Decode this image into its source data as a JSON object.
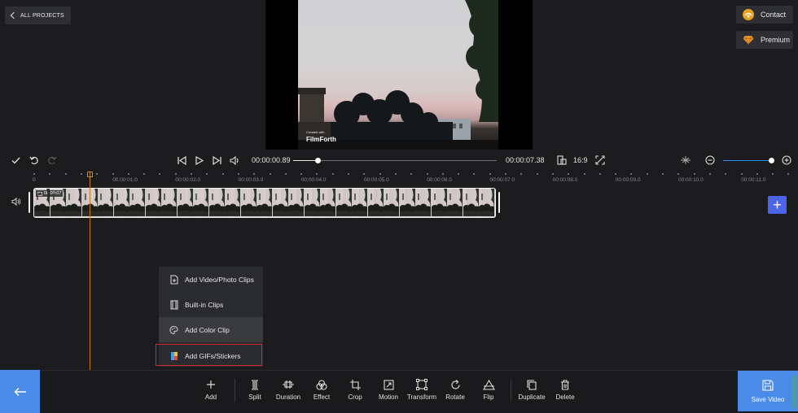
{
  "header": {
    "back_projects_label": "ALL PROJECTS",
    "contact_label": "Contact",
    "premium_label": "Premium"
  },
  "preview": {
    "watermark_small": "Created with",
    "watermark_brand": "FilmForth"
  },
  "controls": {
    "current_time": "00:00:00.89",
    "total_time": "00:00:07.38",
    "aspect_ratio": "16:9",
    "seek_progress": 0.12,
    "zoom_level": 0.97
  },
  "timeline": {
    "ruler_labels": [
      "0",
      "00:00:01.0",
      "00:00:02.0",
      "00:00:03.0",
      "00:00:04.0",
      "00:00:05.0",
      "00:00:06.0",
      "00:00:07.0",
      "00:00:08.0",
      "00:00:09.0",
      "00:00:10.0",
      "00:00:11.0",
      "00:00:12.0"
    ],
    "clip_duration": "00:00:07"
  },
  "add_menu": {
    "items": [
      {
        "label": "Add Video/Photo Clips",
        "icon": "add-file-icon"
      },
      {
        "label": "Built-in Clips",
        "icon": "film-icon"
      },
      {
        "label": "Add Color Clip",
        "icon": "palette-icon"
      },
      {
        "label": "Add GIFs/Stickers",
        "icon": "gif-icon"
      }
    ]
  },
  "toolbar": {
    "add": "Add",
    "split": "Split",
    "duration": "Duration",
    "effect": "Effect",
    "crop": "Crop",
    "motion": "Motion",
    "transform": "Transform",
    "rotate": "Rotate",
    "flip": "Flip",
    "duplicate": "Duplicate",
    "delete": "Delete",
    "save_video": "Save Video"
  },
  "colors": {
    "accent_blue": "#4a8be8",
    "add_track_blue": "#4d64e8",
    "playhead_orange": "#c37a1e",
    "highlight_red": "#d9262b"
  }
}
